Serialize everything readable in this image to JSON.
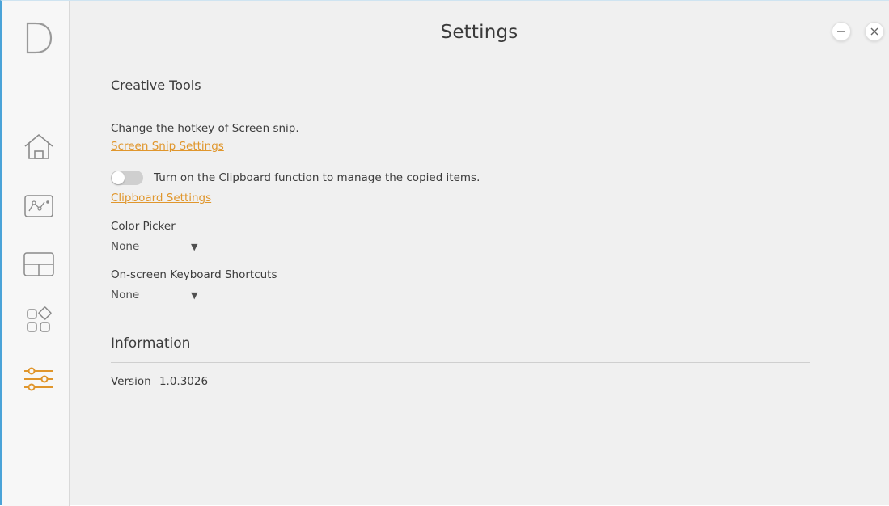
{
  "window": {
    "title": "Settings",
    "accent_color": "#e0962c"
  },
  "sidebar": {
    "logo_letter": "D",
    "items": [
      {
        "icon": "home-icon",
        "label": "Home"
      },
      {
        "icon": "graph-icon",
        "label": "Graph"
      },
      {
        "icon": "layout-icon",
        "label": "Layout"
      },
      {
        "icon": "apps-icon",
        "label": "Apps"
      },
      {
        "icon": "sliders-icon",
        "label": "Settings",
        "active": true
      }
    ]
  },
  "creative_tools": {
    "heading": "Creative Tools",
    "hotkey_text": "Change the hotkey of Screen snip.",
    "screen_snip_link": "Screen Snip Settings",
    "clipboard_toggle_text": "Turn on the Clipboard function to manage the copied items.",
    "clipboard_toggle_on": false,
    "clipboard_link": "Clipboard Settings",
    "color_picker": {
      "label": "Color Picker",
      "value": "None",
      "arrow": "▼"
    },
    "keyboard_shortcuts": {
      "label": "On-screen Keyboard Shortcuts",
      "value": "None",
      "arrow": "▼"
    }
  },
  "information": {
    "heading": "Information",
    "version_label": "Version",
    "version_value": "1.0.3026"
  }
}
